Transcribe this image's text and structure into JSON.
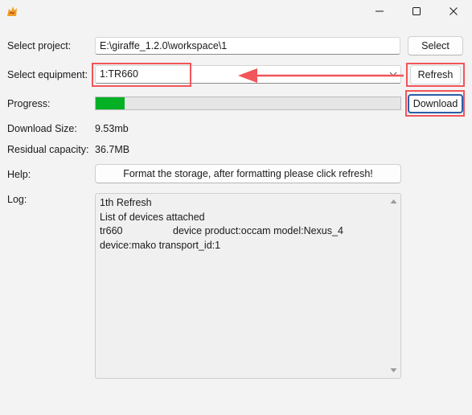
{
  "titlebar": {
    "icons": {
      "app": "giraffe-logo-icon",
      "minimize": "minimize-icon",
      "maximize": "maximize-icon",
      "close": "close-icon"
    }
  },
  "project": {
    "label": "Select project:",
    "path": "E:\\giraffe_1.2.0\\workspace\\1",
    "select_button": "Select"
  },
  "equipment": {
    "label": "Select equipment:",
    "selected": "1:TR660",
    "refresh_button": "Refresh"
  },
  "progress": {
    "label": "Progress:",
    "percent": 9.5,
    "download_button": "Download"
  },
  "info": {
    "download_size_label": "Download Size:",
    "download_size_value": "9.53mb",
    "residual_label": "Residual capacity:",
    "residual_value": "36.7MB"
  },
  "help": {
    "label": "Help:",
    "button": "Format the storage, after formatting please click refresh!"
  },
  "log": {
    "label": "Log:",
    "lines": [
      "1th Refresh",
      "List of devices attached",
      "tr660                  device product:occam model:Nexus_4",
      "device:mako transport_id:1"
    ]
  },
  "colors": {
    "annotation": "#f2555a",
    "progress_fill": "#06b025",
    "focus_border": "#2b5fa8"
  }
}
